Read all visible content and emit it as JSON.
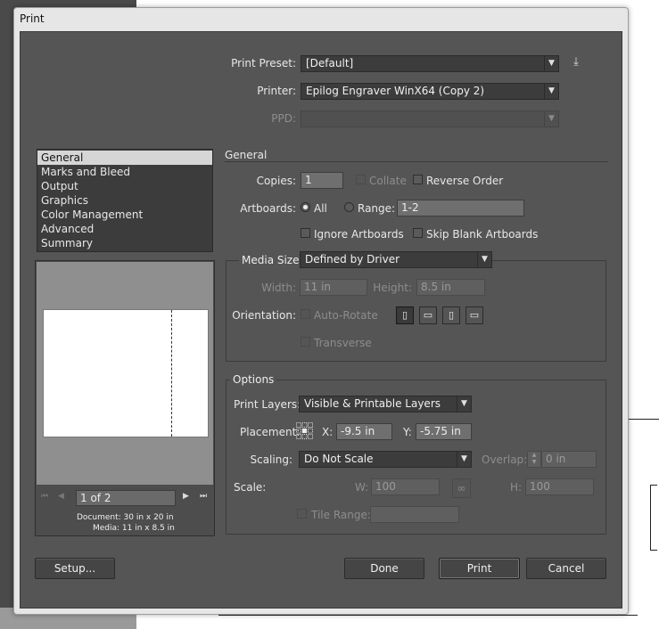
{
  "dialog": {
    "title": "Print",
    "print_preset": {
      "label": "Print Preset:",
      "value": "[Default]"
    },
    "printer": {
      "label": "Printer:",
      "value": "Epilog Engraver WinX64 (Copy 2)"
    },
    "ppd": {
      "label": "PPD:",
      "value": ""
    },
    "categories": [
      "General",
      "Marks and Bleed",
      "Output",
      "Graphics",
      "Color Management",
      "Advanced",
      "Summary"
    ],
    "selected_category": "General",
    "preview": {
      "page_value": "1 of 2",
      "document_text": "Document: 30 in x 20 in",
      "media_text": "Media: 11 in x 8.5 in"
    },
    "general": {
      "heading": "General",
      "copies": {
        "label": "Copies:",
        "value": "1"
      },
      "collate_label": "Collate",
      "reverse_order_label": "Reverse Order",
      "artboards_label": "Artboards:",
      "all_label": "All",
      "range_label": "Range:",
      "range_value": "1-2",
      "ignore_artboards_label": "Ignore Artboards",
      "skip_blank_label": "Skip Blank Artboards"
    },
    "media": {
      "size_label": "Media Size:",
      "size_value": "Defined by Driver",
      "width_label": "Width:",
      "width_value": "11 in",
      "height_label": "Height:",
      "height_value": "8.5 in",
      "orientation_label": "Orientation:",
      "auto_rotate_label": "Auto-Rotate",
      "transverse_label": "Transverse"
    },
    "options": {
      "heading": "Options",
      "print_layers_label": "Print Layers:",
      "print_layers_value": "Visible & Printable Layers",
      "placement_label": "Placement:",
      "x_label": "X:",
      "x_value": "-9.5 in",
      "y_label": "Y:",
      "y_value": "-5.75 in",
      "scaling_label": "Scaling:",
      "scaling_value": "Do Not Scale",
      "overlap_label": "Overlap:",
      "overlap_value": "0 in",
      "scale_label": "Scale:",
      "w_label": "W:",
      "w_value": "100",
      "h_label": "H:",
      "h_value": "100",
      "tile_range_label": "Tile Range:",
      "tile_range_value": ""
    },
    "buttons": {
      "setup": "Setup...",
      "done": "Done",
      "print": "Print",
      "cancel": "Cancel"
    }
  }
}
